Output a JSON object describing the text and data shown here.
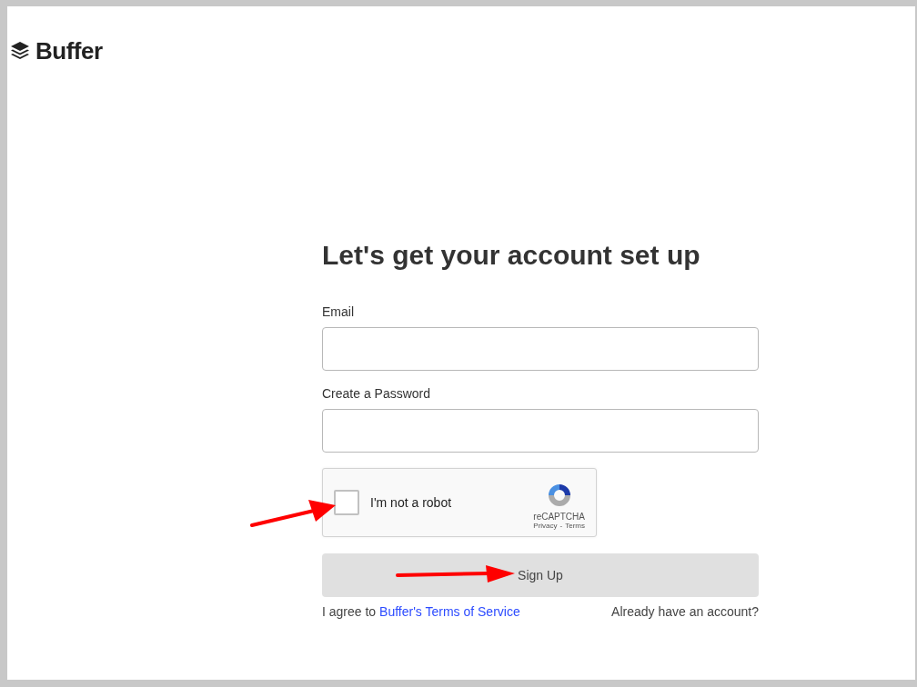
{
  "logo": {
    "text": "Buffer"
  },
  "heading": "Let's get your account set up",
  "fields": [
    {
      "label": "Email"
    },
    {
      "label": "Create a Password"
    }
  ],
  "captcha": {
    "label": "I'm not a robot",
    "checked": false,
    "brand": "reCAPTCHA",
    "links": [
      "Privacy",
      "Terms"
    ],
    "separator": "-"
  },
  "submit_button": "Sign Up",
  "terms": {
    "prefix": "I agree to",
    "link": "Buffer's Terms of Service"
  },
  "login_link": "Already have an account?",
  "annotations": [
    {
      "kind": "arrow"
    },
    {
      "kind": "arrow"
    }
  ]
}
